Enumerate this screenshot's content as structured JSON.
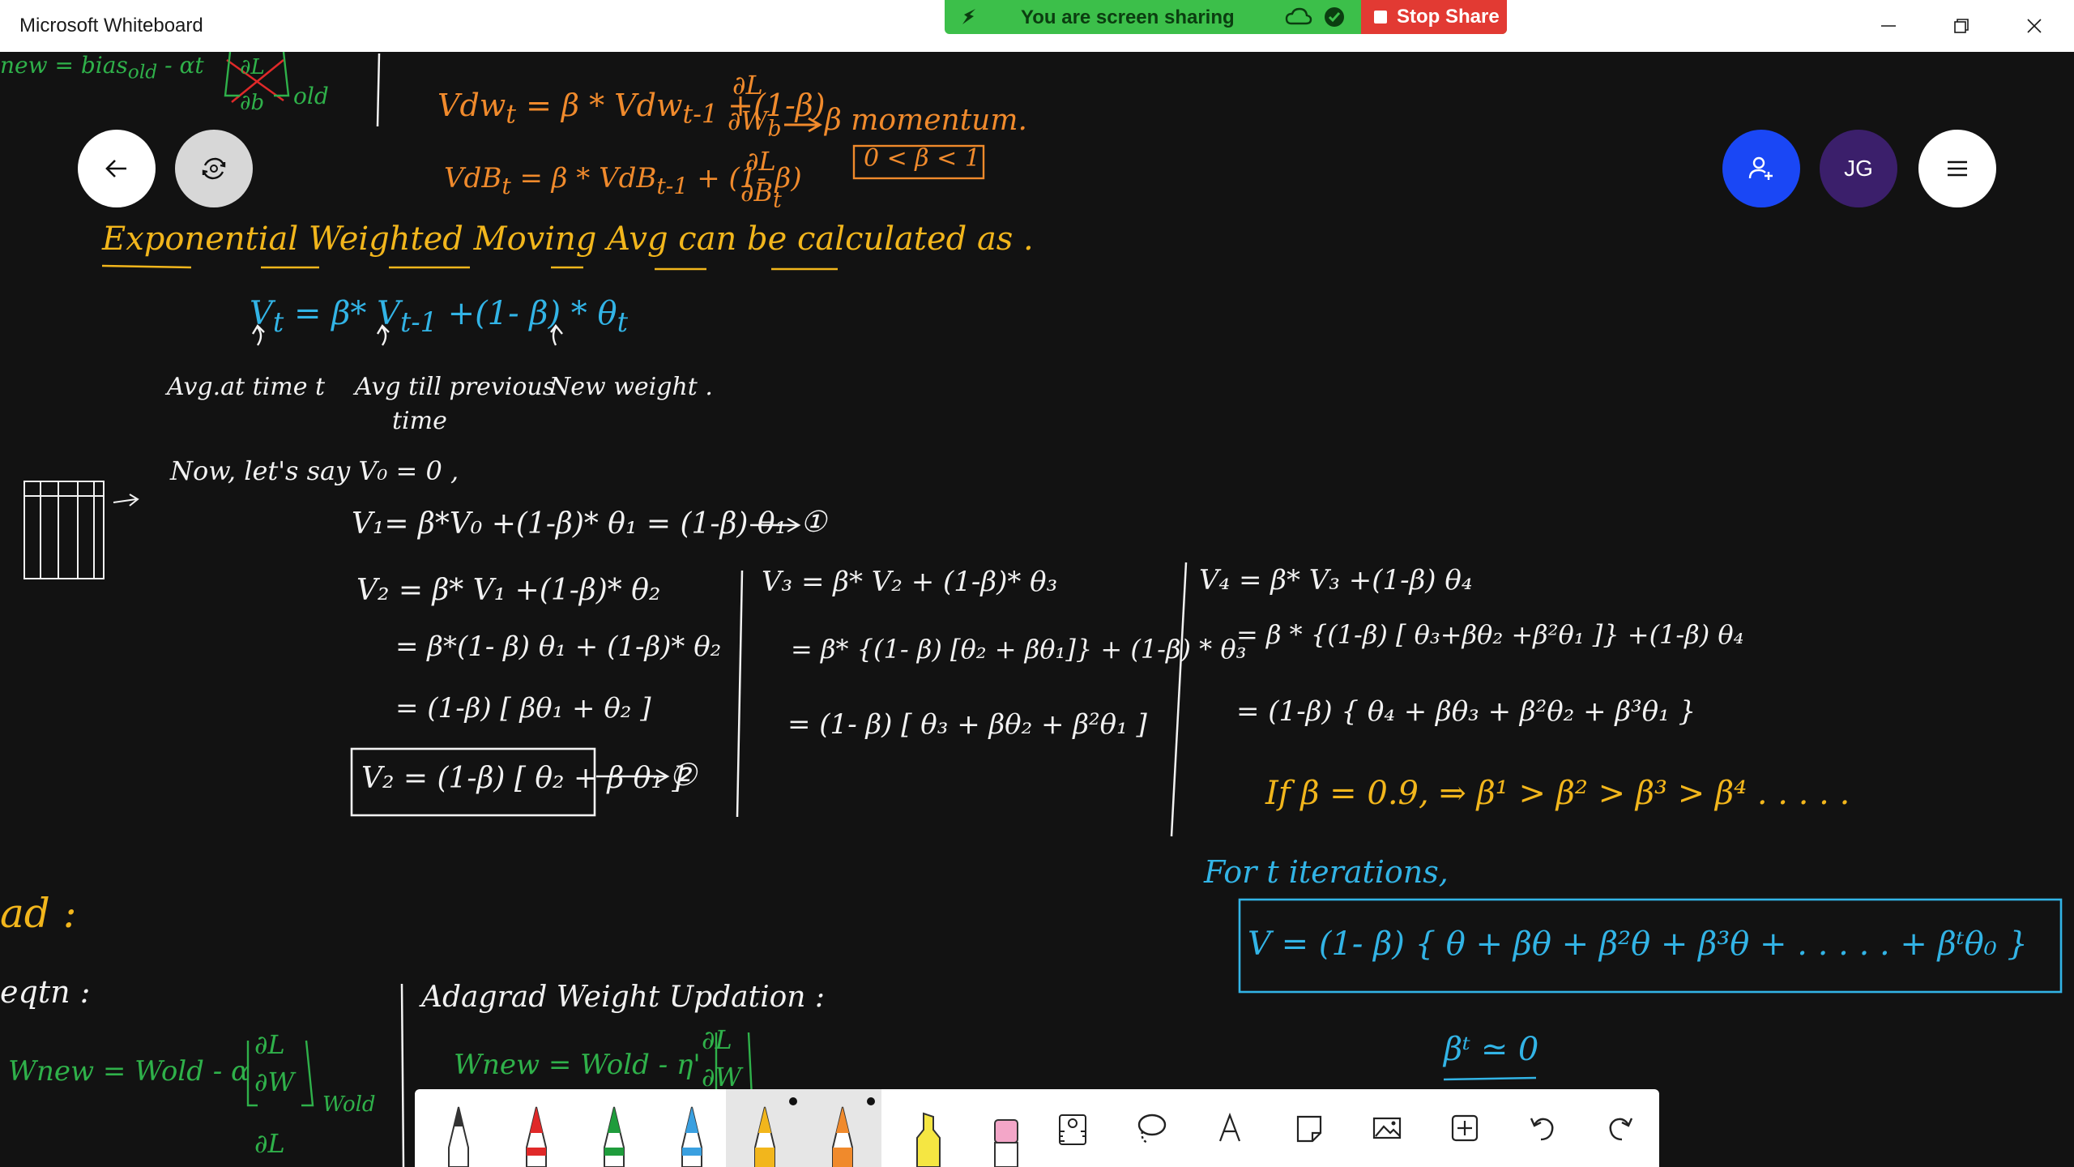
{
  "window": {
    "title": "Microsoft Whiteboard",
    "controls": [
      "minimize-icon",
      "restore-icon",
      "close-icon"
    ]
  },
  "share_banner": {
    "text": "You are screen sharing",
    "stop_label": "Stop Share",
    "color": "#3cbf4a",
    "stop_color": "#e23a33"
  },
  "fab": {
    "avatar_initials": "JG",
    "invite_color": "#1a47f5",
    "avatar_color": "#3b1f6b"
  },
  "board": {
    "top_eq": {
      "vdw": "Vdw",
      "vdw_sub": "t",
      "vdw_rhs": "= β * Vdw",
      "vdw_rhs_sub": "t-1",
      "vdw_tail": "+(1-β)",
      "frac_num": "∂L",
      "frac_den": "∂W",
      "frac_den_sub": "b",
      "momentum": "β  momentum.",
      "range": "0 < β < 1",
      "vdb": "VdB",
      "vdb_sub": "t",
      "vdb_rhs": "= β *  VdB",
      "vdb_rhs_sub": "t-1",
      "vdb_tail": "+ (1- β)",
      "vdb_frac_num": "∂L",
      "vdb_frac_den": "∂B",
      "vdb_frac_den_sub": "t"
    },
    "ewma_title": "Exponential Weighted Moving Avg  can be  calculated as .",
    "main_formula": "V",
    "main_formula_sub": "t",
    "main_formula_rhs": "= β* V",
    "main_formula_rhs_sub": "t-1",
    "main_formula_tail": "+(1- β) * θ",
    "main_formula_tail_sub": "t",
    "labels": {
      "avg_at_t": "Avg.at time t",
      "avg_prev": "Avg till previous",
      "avg_prev2": "time",
      "new_weight": "New weight ."
    },
    "now_line": "Now,  let's say  V₀ = 0 ,",
    "v1": "V₁= β*V₀ +(1-β)* θ₁   = (1-β) θ₁",
    "v1_ref": "①",
    "v2_lines": [
      "V₂ = β* V₁  +(1-β)* θ₂",
      "= β*(1- β) θ₁  + (1-β)* θ₂",
      "= (1-β) [ βθ₁ + θ₂ ]"
    ],
    "v2_box": "V₂ = (1-β) [ θ₂ + β θ₁ ]",
    "v2_ref": "②",
    "v3_lines": [
      "V₃ =  β* V₂  + (1-β)* θ₃",
      "= β* {(1- β) [θ₂ + βθ₁]} + (1-β) * θ₃",
      "= (1- β) [ θ₃ + βθ₂ + β²θ₁ ]"
    ],
    "v4_lines": [
      "V₄  =  β* V₃ +(1-β) θ₄",
      "= β * {(1-β) [ θ₃+βθ₂ +β²θ₁ ]} +(1-β) θ₄",
      "= (1-β) { θ₄ + βθ₃ + β²θ₂ + β³θ₁ }"
    ],
    "if_line": "If   β = 0.9,  ⇒  β¹ > β² > β³ > β⁴ . . . . .",
    "for_t": "For  t  iterations,",
    "final_box": "V  = (1- β) { θ  + βθ     + β²θ     + β³θ     +  . .   . . .   + βᵗθ₀ }",
    "beta_t": "βᵗ ≃ 0",
    "left_partial": [
      "new  =  bias",
      "old",
      "- αt",
      "∂L",
      "∂b",
      "old"
    ],
    "ad": "ad :",
    "eqtn": "eqtn :",
    "w_update": "W",
    "w_update_text": "new = Wold - α",
    "w_frac": "∂L",
    "w_frac_den": "∂W",
    "w_old": "Wold",
    "adagrad_title": "Adagrad  Weight  Updation :",
    "adagrad_eq": "Wnew =  Wold  - η'",
    "adagrad_frac": "∂L",
    "adagrad_frac_den": "∂W",
    "bottom_partial": "∂L"
  },
  "toolbar": {
    "pens": [
      {
        "name": "pen-white",
        "color": "#ffffff"
      },
      {
        "name": "pen-red",
        "color": "#e02929"
      },
      {
        "name": "pen-green",
        "color": "#1f9c3c"
      },
      {
        "name": "pen-blue",
        "color": "#3aa0e0"
      },
      {
        "name": "pen-yellow",
        "color": "#f2b61c",
        "selected": true
      },
      {
        "name": "pen-orange",
        "color": "#f08a2c",
        "selected": true
      }
    ],
    "highlighter_color": "#f5e642",
    "eraser_color": "#f3a6c8",
    "icons": [
      "ruler-icon",
      "lasso-icon",
      "text-icon",
      "note-icon",
      "image-icon",
      "add-icon",
      "undo-icon",
      "redo-icon"
    ]
  }
}
